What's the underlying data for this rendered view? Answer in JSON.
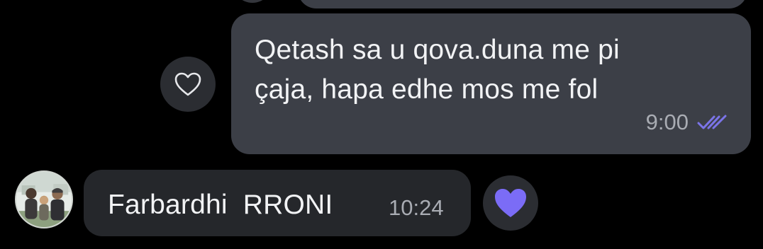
{
  "messages": {
    "outgoing": {
      "text": "Qetash sa u qova.duna me pi\nçaja, hapa edhe mos me fol",
      "time": "9:00",
      "status_icon": "double-check-read-icon",
      "reaction_icon": "heart-outline-icon"
    },
    "incoming": {
      "text": "Farbardhi  RRONI",
      "time": "10:24",
      "sender_avatar": "avatar-photo",
      "reaction_icon": "heart-filled-icon"
    }
  },
  "colors": {
    "background": "#000000",
    "bubble_outgoing": "#3c3f47",
    "bubble_incoming": "#25272b",
    "reaction_button": "#2b2d32",
    "accent_heart": "#7b6cf6",
    "read_check": "#7b74e8",
    "text_primary": "#f2f3f5",
    "text_secondary": "#a9acb3"
  }
}
